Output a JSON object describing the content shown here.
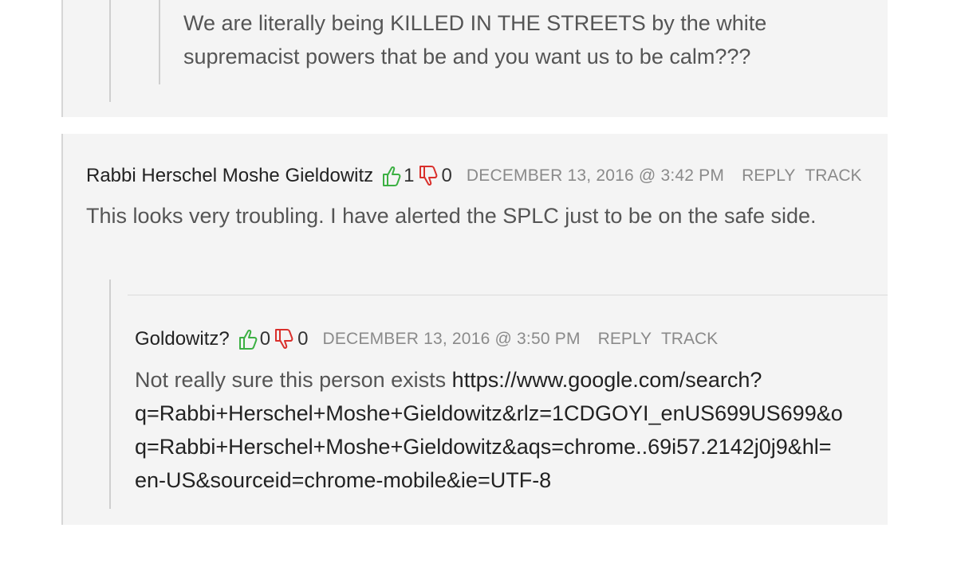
{
  "top_comment": {
    "text": "We are literally being KILLED IN THE STREETS by the white supremacist powers that be and you want us to be calm???"
  },
  "comment": {
    "author": "Rabbi Herschel Moshe Gieldowitz",
    "upvotes": "1",
    "downvotes": "0",
    "timestamp": "DECEMBER 13, 2016 @ 3:42 PM",
    "reply_label": "REPLY",
    "track_label": "TRACK",
    "body": "This looks very troubling. I have alerted the SPLC just to be on the safe side."
  },
  "reply": {
    "author": "Goldowitz?",
    "upvotes": "0",
    "downvotes": "0",
    "timestamp": "DECEMBER 13, 2016 @ 3:50 PM",
    "reply_label": "REPLY",
    "track_label": "TRACK",
    "body_prefix": "Not really sure this person exists",
    "url_line_1": "https://www.google.com/search?",
    "url_line_2": "q=Rabbi+Herschel+Moshe+Gieldowitz&rlz=1CDGOYI_enUS699US699&o",
    "url_line_3": "q=Rabbi+Herschel+Moshe+Gieldowitz&aqs=chrome..69i57.2142j0j9&hl=",
    "url_line_4": "en-US&sourceid=chrome-mobile&ie=UTF-8"
  },
  "colors": {
    "upvote": "#3cb043",
    "downvote": "#d9302c",
    "background": "#f4f4f4"
  },
  "icons": {
    "upvote": "thumbs-up-icon",
    "downvote": "thumbs-down-icon"
  }
}
